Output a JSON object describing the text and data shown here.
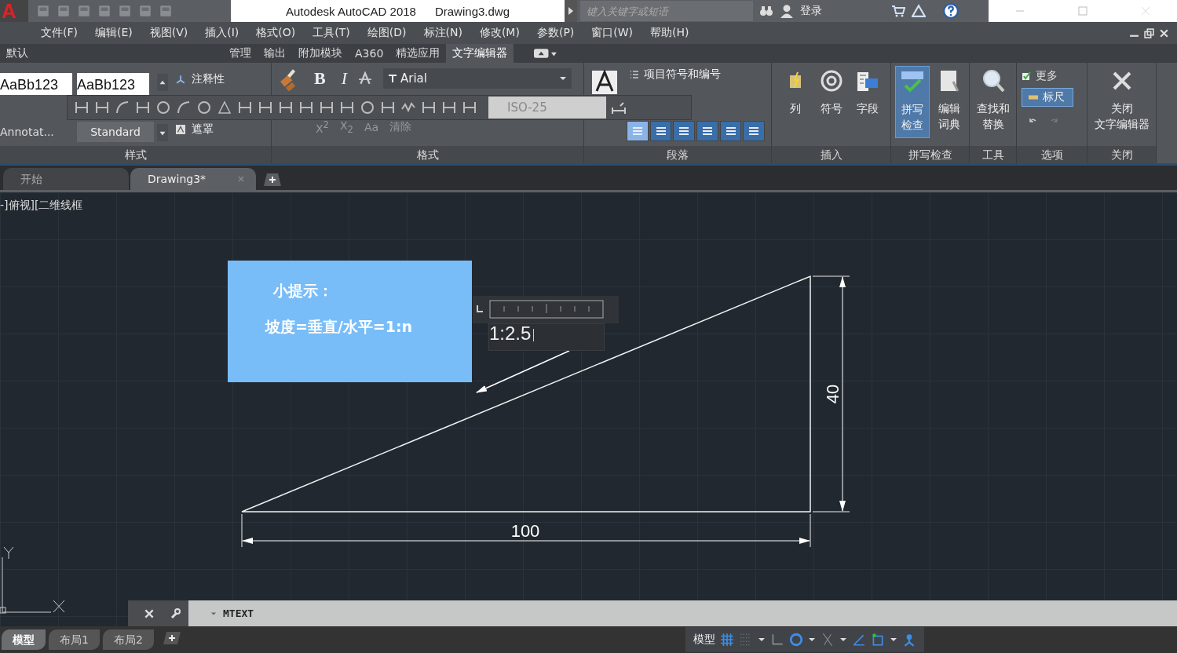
{
  "title_bar": {
    "logo": "A",
    "app_title": "Autodesk AutoCAD 2018",
    "file_name": "Drawing3.dwg",
    "search_placeholder": "键入关键字或短语",
    "login": "登录"
  },
  "menu": [
    "文件(F)",
    "编辑(E)",
    "视图(V)",
    "插入(I)",
    "格式(O)",
    "工具(T)",
    "绘图(D)",
    "标注(N)",
    "修改(M)",
    "参数(P)",
    "窗口(W)",
    "帮助(H)"
  ],
  "ribbon_tabs": [
    {
      "label": "默认",
      "selected": false
    },
    {
      "label": "管理",
      "selected": false
    },
    {
      "label": "输出",
      "selected": false
    },
    {
      "label": "附加模块",
      "selected": false
    },
    {
      "label": "A360",
      "selected": false
    },
    {
      "label": "精选应用",
      "selected": false
    },
    {
      "label": "文字编辑器",
      "selected": true
    }
  ],
  "style_panel": {
    "samples": [
      "AaBb123",
      "AaBb123"
    ],
    "annotative": "注释性",
    "style_name": "Annotat...",
    "style_value": "Standard",
    "mask": "遮罩",
    "title": "样式"
  },
  "format_panel": {
    "bold": "B",
    "italic": "I",
    "font": "Arial",
    "text_tools": [
      {
        "label": "X$^{2}$",
        "disabled": true
      },
      {
        "label": "X$_{2}$",
        "disabled": true
      },
      {
        "label": "Aa",
        "disabled": true
      },
      {
        "label": "清除",
        "disabled": true
      }
    ],
    "title": "格式"
  },
  "dimension_toolbar": {
    "dim_style": "ISO-25"
  },
  "paragraph_panel": {
    "bullets": "项目符号和编号",
    "alignments": [
      {
        "selected": true
      },
      {
        "selected": false
      },
      {
        "selected": false
      },
      {
        "selected": false
      },
      {
        "selected": false
      },
      {
        "selected": false
      }
    ],
    "title": "段落"
  },
  "insert_panel": {
    "buttons": [
      "列",
      "符号",
      "字段"
    ],
    "title": "插入"
  },
  "spell_panel": {
    "buttons": [
      {
        "lines": [
          "拼写",
          "检查"
        ],
        "on": true
      },
      {
        "lines": [
          "编辑",
          "词典"
        ],
        "on": false
      }
    ],
    "title": "拼写检查"
  },
  "tools_panel": {
    "button": [
      "查找和",
      "替换"
    ],
    "title": "工具"
  },
  "options_panel": {
    "more": "更多",
    "ruler": {
      "label": "标尺",
      "on": true
    },
    "title": "选项"
  },
  "close_panel": {
    "button": [
      "关闭",
      "文字编辑器"
    ],
    "title": "关闭"
  },
  "doc_tabs": [
    {
      "label": "开始",
      "selected": false
    },
    {
      "label": "Drawing3*",
      "selected": true
    }
  ],
  "viewport_label": "-]俯视][二维线框",
  "drawing": {
    "tip_title": "小提示：",
    "tip_text": "坡度=垂直/水平=1:n",
    "mtext": "1:2.5",
    "width_dim": "100",
    "height_dim": "40"
  },
  "command_line": {
    "text": "MTEXT"
  },
  "layout_tabs": [
    {
      "label": "模型",
      "selected": true
    },
    {
      "label": "布局1",
      "selected": false
    },
    {
      "label": "布局2",
      "selected": false
    }
  ],
  "status_bar": {
    "space": "模型"
  }
}
